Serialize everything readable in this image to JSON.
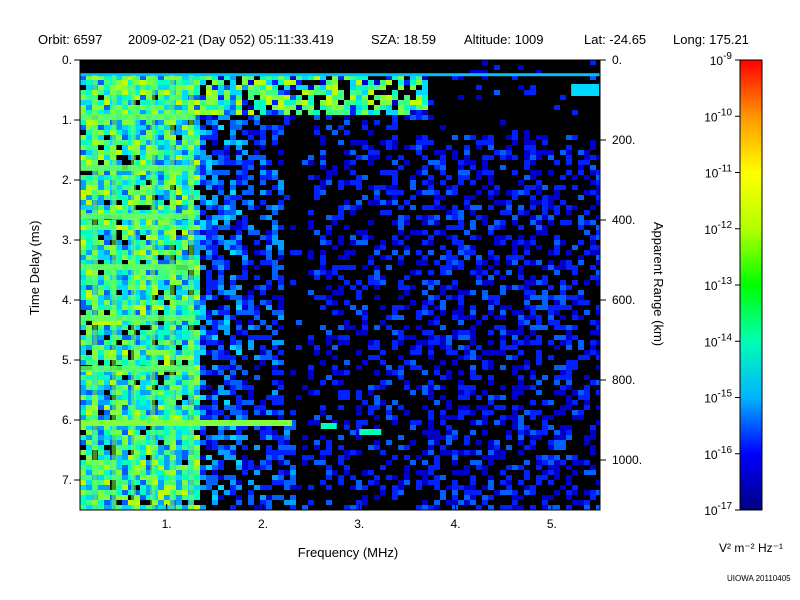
{
  "header": {
    "orbit": "Orbit: 6597",
    "datetime": "2009-02-21 (Day 052) 05:11:33.419",
    "sza": "SZA:  18.59",
    "altitude": "Altitude:     1009",
    "lat": "Lat: -24.65",
    "long": "Long: 175.21"
  },
  "chart_data": {
    "type": "heatmap",
    "xlabel": "Frequency (MHz)",
    "ylabel": "Time Delay (ms)",
    "y2label": "Apparent Range (km)",
    "xlim": [
      0.1,
      5.5
    ],
    "ylim": [
      0,
      7.5
    ],
    "y2lim": [
      0,
      1125
    ],
    "x_ticks": [
      {
        "v": 1,
        "label": "1."
      },
      {
        "v": 2,
        "label": "2."
      },
      {
        "v": 3,
        "label": "3."
      },
      {
        "v": 4,
        "label": "4."
      },
      {
        "v": 5,
        "label": "5."
      }
    ],
    "y_ticks": [
      {
        "v": 0,
        "label": "0."
      },
      {
        "v": 1,
        "label": "1."
      },
      {
        "v": 2,
        "label": "2."
      },
      {
        "v": 3,
        "label": "3."
      },
      {
        "v": 4,
        "label": "4."
      },
      {
        "v": 5,
        "label": "5."
      },
      {
        "v": 6,
        "label": "6."
      },
      {
        "v": 7,
        "label": "7."
      }
    ],
    "y2_ticks": [
      {
        "v": 0,
        "label": "0."
      },
      {
        "v": 200,
        "label": "200."
      },
      {
        "v": 400,
        "label": "400."
      },
      {
        "v": 600,
        "label": "600."
      },
      {
        "v": 800,
        "label": "800."
      },
      {
        "v": 1000,
        "label": "1000."
      }
    ],
    "colorbar": {
      "unit": "V² m⁻² Hz⁻¹",
      "min_exp": -17,
      "max_exp": -9,
      "tick_exps": [
        -9,
        -10,
        -11,
        -12,
        -13,
        -14,
        -15,
        -16,
        -17
      ],
      "colors": [
        "#000080",
        "#0000ff",
        "#00b4ff",
        "#00ffb4",
        "#00ff00",
        "#b4ff00",
        "#ffff00",
        "#ff9600",
        "#ff0000"
      ]
    },
    "features": {
      "ground_echo_delay_ms": 6.05,
      "ground_echo_freq_range_mhz": [
        0.1,
        3.3
      ],
      "surface_reflection_band_ms": [
        0.25,
        1.0
      ],
      "plasma_lines_freq_max_mhz": 1.3,
      "background_freq_max_mhz": 5.5
    }
  },
  "credit": "UIOWA 20110405"
}
